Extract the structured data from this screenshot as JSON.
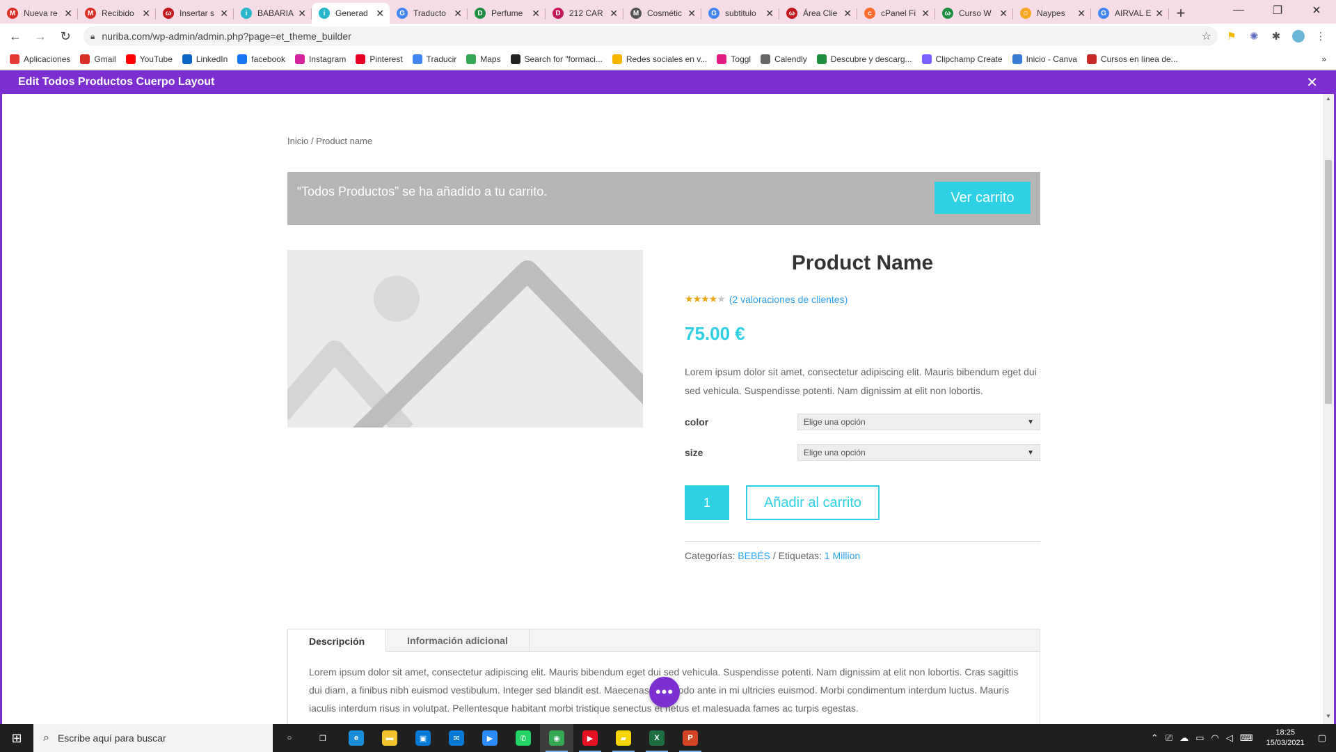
{
  "browser": {
    "tabs": [
      {
        "title": "Nueva re",
        "icon": "gmail-icon",
        "color": "#d93025",
        "glyph": "M"
      },
      {
        "title": "Recibido",
        "icon": "gmail-icon",
        "color": "#d93025",
        "glyph": "M"
      },
      {
        "title": "Insertar s",
        "icon": "wordpress-red-icon",
        "color": "#c4161c",
        "glyph": "ω"
      },
      {
        "title": "BABARIA",
        "icon": "babaria-icon",
        "color": "#26b5c9",
        "glyph": "i"
      },
      {
        "title": "Generad",
        "icon": "generator-icon",
        "color": "#26b5c9",
        "glyph": "i"
      },
      {
        "title": "Traducto",
        "icon": "translate-icon",
        "color": "#4285f4",
        "glyph": "G"
      },
      {
        "title": "Perfume",
        "icon": "dd-icon",
        "color": "#1e8e3e",
        "glyph": "D"
      },
      {
        "title": "212 CAR",
        "icon": "d-icon",
        "color": "#c2185b",
        "glyph": "D"
      },
      {
        "title": "Cosmétic",
        "icon": "gmail-icon",
        "color": "#555555",
        "glyph": "M"
      },
      {
        "title": "subtitulo",
        "icon": "google-icon",
        "color": "#4285f4",
        "glyph": "G"
      },
      {
        "title": "Área Clie",
        "icon": "wordpress-red-icon",
        "color": "#c4161c",
        "glyph": "ω"
      },
      {
        "title": "cPanel Fi",
        "icon": "cpanel-icon",
        "color": "#ff6c2c",
        "glyph": "c"
      },
      {
        "title": "Curso W",
        "icon": "wix-icon",
        "color": "#1e8e3e",
        "glyph": "ω"
      },
      {
        "title": "Naypes",
        "icon": "naypes-icon",
        "color": "#f5a623",
        "glyph": "☺"
      },
      {
        "title": "AIRVAL E",
        "icon": "google-icon",
        "color": "#4285f4",
        "glyph": "G"
      }
    ],
    "active_tab": 4,
    "url": "nuriba.com/wp-admin/admin.php?page=et_theme_builder",
    "bookmarks": [
      {
        "label": "Aplicaciones",
        "icon": "apps-grid-icon",
        "color": "#e53935"
      },
      {
        "label": "Gmail",
        "icon": "gmail-icon",
        "color": "#d93025"
      },
      {
        "label": "YouTube",
        "icon": "youtube-icon",
        "color": "#ff0000"
      },
      {
        "label": "LinkedIn",
        "icon": "linkedin-icon",
        "color": "#0a66c2"
      },
      {
        "label": "facebook",
        "icon": "facebook-icon",
        "color": "#1877f2"
      },
      {
        "label": "Instagram",
        "icon": "instagram-icon",
        "color": "#d6249f"
      },
      {
        "label": "Pinterest",
        "icon": "pinterest-icon",
        "color": "#e60023"
      },
      {
        "label": "Traducir",
        "icon": "translate-icon",
        "color": "#4285f4"
      },
      {
        "label": "Maps",
        "icon": "maps-icon",
        "color": "#34a853"
      },
      {
        "label": "Search for \"formaci...",
        "icon": "search-globe-icon",
        "color": "#222222"
      },
      {
        "label": "Redes sociales en v...",
        "icon": "redes-icon",
        "color": "#f4b400"
      },
      {
        "label": "Toggl",
        "icon": "toggl-icon",
        "color": "#e01b84"
      },
      {
        "label": "Calendly",
        "icon": "calendly-icon",
        "color": "#666666"
      },
      {
        "label": "Descubre y descarg...",
        "icon": "px-icon",
        "color": "#1e8e3e"
      },
      {
        "label": "Clipchamp Create",
        "icon": "clipchamp-icon",
        "color": "#7b61ff"
      },
      {
        "label": "Inicio - Canva",
        "icon": "canva-icon",
        "color": "#3a7bd5"
      },
      {
        "label": "Cursos en línea de...",
        "icon": "udemy-icon",
        "color": "#c62828"
      }
    ]
  },
  "builder": {
    "title": "Edit Todos Productos Cuerpo Layout",
    "close": "✕"
  },
  "page": {
    "breadcrumb": "Inicio / Product name",
    "notice": {
      "message": "“Todos Productos” se ha añadido a tu carrito.",
      "button": "Ver carrito"
    },
    "product": {
      "name": "Product Name",
      "rating": 4,
      "rating_max": 5,
      "reviews_link": "(2 valoraciones de clientes)",
      "price": "75.00 €",
      "description": "Lorem ipsum dolor sit amet, consectetur adipiscing elit. Mauris bibendum eget dui sed vehicula. Suspendisse potenti. Nam dignissim at elit non lobortis.",
      "variations": [
        {
          "label": "color",
          "placeholder": "Elige una opción"
        },
        {
          "label": "size",
          "placeholder": "Elige una opción"
        }
      ],
      "quantity": "1",
      "add_to_cart": "Añadir al carrito",
      "meta": {
        "categories_label": "Categorías:",
        "category": "BEBÉS",
        "separator": "/",
        "tags_label": "Etiquetas:",
        "tag": "1 Million"
      }
    },
    "tabs": {
      "items": [
        "Descripción",
        "Información adicional"
      ],
      "active": 0,
      "body": "Lorem ipsum dolor sit amet, consectetur adipiscing elit. Mauris bibendum eget dui sed vehicula. Suspendisse potenti. Nam dignissim at elit non lobortis. Cras sagittis dui diam, a finibus nibh euismod vestibulum. Integer sed blandit est. Maecenas commodo ante in mi ultricies euismod. Morbi condimentum interdum luctus. Mauris iaculis interdum risus in volutpat. Pellentesque habitant morbi tristique senectus et netus et malesuada fames ac turpis egestas."
    },
    "fab": "•••"
  },
  "taskbar": {
    "search_placeholder": "Escribe aquí para buscar",
    "apps": [
      {
        "name": "cortana-icon",
        "glyph": "○",
        "color": "#1f1f1f"
      },
      {
        "name": "task-view-icon",
        "glyph": "❐",
        "color": "#1f1f1f"
      },
      {
        "name": "edge-icon",
        "glyph": "e",
        "color": "#1a8fd9"
      },
      {
        "name": "file-explorer-icon",
        "glyph": "▬",
        "color": "#f4c430"
      },
      {
        "name": "store-icon",
        "glyph": "▣",
        "color": "#0078d4"
      },
      {
        "name": "mail-icon",
        "glyph": "✉",
        "color": "#0078d4"
      },
      {
        "name": "zoom-icon",
        "glyph": "▶",
        "color": "#2d8cff"
      },
      {
        "name": "whatsapp-icon",
        "glyph": "✆",
        "color": "#25d366"
      },
      {
        "name": "chrome-icon",
        "glyph": "◉",
        "color": "#34a853"
      },
      {
        "name": "media-player-icon",
        "glyph": "▶",
        "color": "#e81123"
      },
      {
        "name": "sticky-notes-icon",
        "glyph": "▰",
        "color": "#f7d500"
      },
      {
        "name": "excel-icon",
        "glyph": "X",
        "color": "#1d6f42"
      },
      {
        "name": "powerpoint-icon",
        "glyph": "P",
        "color": "#d24726"
      }
    ],
    "time": "18:25",
    "date": "15/03/2021"
  },
  "colors": {
    "builder_purple": "#7b2fd1",
    "accent_cyan": "#2ed1e4",
    "link_blue": "#2ea3f2",
    "star_gold": "#e6a817"
  }
}
